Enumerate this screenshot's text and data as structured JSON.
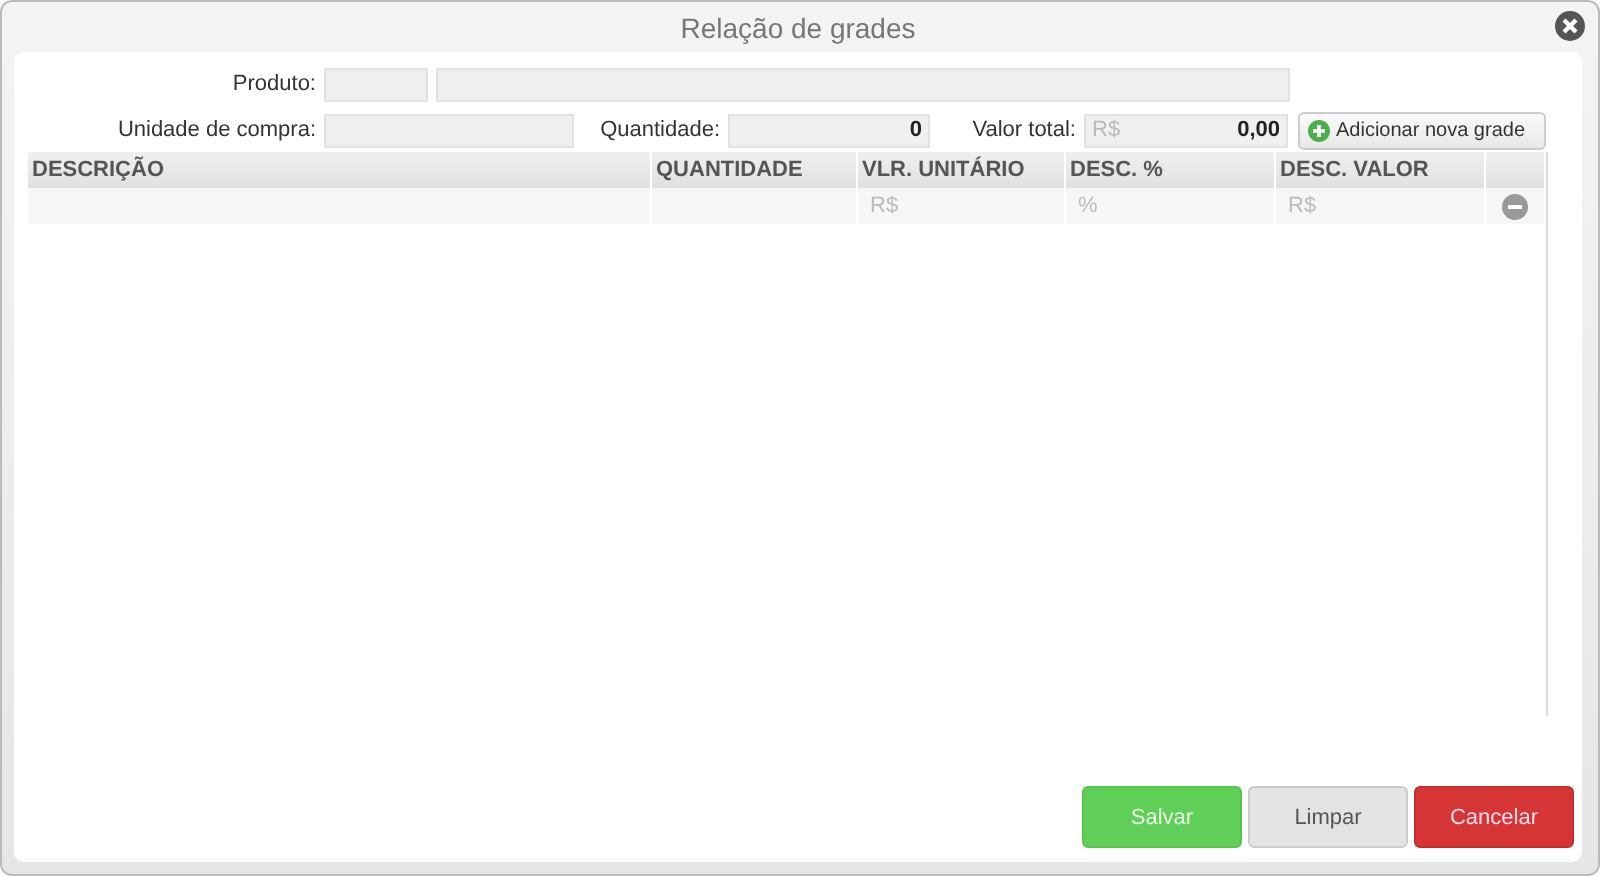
{
  "window": {
    "title": "Relação de grades"
  },
  "form": {
    "produto_label": "Produto:",
    "unidade_label": "Unidade de compra:",
    "quantidade_label": "Quantidade:",
    "quantidade_value": "0",
    "valor_total_label": "Valor total:",
    "valor_total_prefix": "R$",
    "valor_total_value": "0,00",
    "add_button": "Adicionar nova grade"
  },
  "table": {
    "columns": [
      "DESCRIÇÃO",
      "QUANTIDADE",
      "VLR. UNITÁRIO",
      "DESC. %",
      "DESC. VALOR"
    ],
    "rows": [
      {
        "cells": [
          "",
          "",
          "R$",
          "%",
          "R$"
        ]
      }
    ]
  },
  "buttons": [
    {
      "label": "Salvar",
      "kind": "save"
    },
    {
      "label": "Limpar",
      "kind": "clear"
    },
    {
      "label": "Cancelar",
      "kind": "cancel"
    }
  ]
}
